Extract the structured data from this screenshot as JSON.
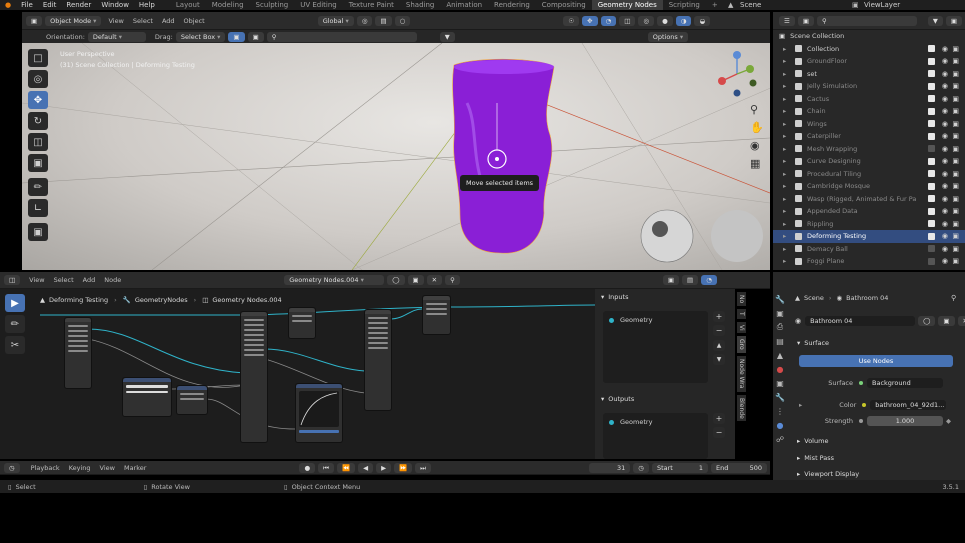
{
  "topbar": {
    "menus": [
      "File",
      "Edit",
      "Render",
      "Window",
      "Help"
    ],
    "workspaces": [
      "Layout",
      "Modeling",
      "Sculpting",
      "UV Editing",
      "Texture Paint",
      "Shading",
      "Animation",
      "Rendering",
      "Compositing",
      "Geometry Nodes",
      "Scripting"
    ],
    "active_workspace": "Geometry Nodes",
    "scene_name": "Scene",
    "view_layer": "ViewLayer"
  },
  "viewport": {
    "mode": "Object Mode",
    "menus": [
      "View",
      "Select",
      "Add",
      "Object"
    ],
    "transform_orientation": "Global",
    "orientation_label": "Orientation:",
    "orientation_value": "Default",
    "drag_label": "Drag:",
    "drag_value": "Select Box",
    "options_label": "Options",
    "overlay_line1": "User Perspective",
    "overlay_line2": "(31) Scene Collection | Deforming Testing",
    "tooltip": "Move selected items",
    "object_color": "#8a1fd6"
  },
  "outliner": {
    "root": "Scene Collection",
    "items": [
      {
        "name": "Collection",
        "state": "normal",
        "checked": true
      },
      {
        "name": "GroundFloor",
        "state": "dim",
        "checked": true
      },
      {
        "name": "set",
        "state": "normal",
        "checked": true
      },
      {
        "name": "Jelly Simulation",
        "state": "dim",
        "checked": true
      },
      {
        "name": "Cactus",
        "state": "dim",
        "checked": true
      },
      {
        "name": "Chain",
        "state": "dim",
        "checked": true
      },
      {
        "name": "Wings",
        "state": "dim",
        "checked": true
      },
      {
        "name": "Caterpiller",
        "state": "dim",
        "checked": true
      },
      {
        "name": "Mesh Wrapping",
        "state": "dim",
        "checked": false
      },
      {
        "name": "Curve Designing",
        "state": "dim",
        "checked": true
      },
      {
        "name": "Procedural Tiling",
        "state": "dim",
        "checked": true
      },
      {
        "name": "Cambridge Mosque",
        "state": "dim",
        "checked": true
      },
      {
        "name": "Wasp (Rigged, Animated & Fur Pa",
        "state": "dim",
        "checked": true
      },
      {
        "name": "Appended Data",
        "state": "dim",
        "checked": true
      },
      {
        "name": "Rippling",
        "state": "dim",
        "checked": true
      },
      {
        "name": "Deforming Testing",
        "state": "selected",
        "checked": true
      },
      {
        "name": "Demacy Ball",
        "state": "dim",
        "checked": false
      },
      {
        "name": "Foggi Plane",
        "state": "dim",
        "checked": false
      }
    ]
  },
  "node_editor": {
    "menus": [
      "View",
      "Select",
      "Add",
      "Node"
    ],
    "node_tree": "Geometry Nodes.004",
    "breadcrumb": [
      "Deforming Testing",
      "GeometryNodes",
      "Geometry Nodes.004"
    ],
    "side_tabs": [
      "No",
      "T",
      "Vi",
      "Gro",
      "Node Wra",
      "Blende"
    ],
    "inputs_label": "Inputs",
    "outputs_label": "Outputs",
    "input_socket": "Geometry",
    "output_socket": "Geometry"
  },
  "properties": {
    "breadcrumb_scene": "Scene",
    "breadcrumb_world": "Bathroom 04",
    "world_name": "Bathroom 04",
    "surface_label": "Surface",
    "use_nodes_label": "Use Nodes",
    "surface_field_label": "Surface",
    "surface_value": "Background",
    "color_label": "Color",
    "color_value": "bathroom_04_92d1...",
    "strength_label": "Strength",
    "strength_value": "1.000",
    "panels": [
      "Volume",
      "Mist Pass",
      "Viewport Display"
    ]
  },
  "timeline": {
    "menus": [
      "Playback",
      "Keying",
      "View",
      "Marker"
    ],
    "current_frame": "31",
    "start_label": "Start",
    "start_value": "1",
    "end_label": "End",
    "end_value": "500"
  },
  "statusbar": {
    "select": "Select",
    "rotate": "Rotate View",
    "context": "Object Context Menu",
    "version": "3.5.1"
  }
}
